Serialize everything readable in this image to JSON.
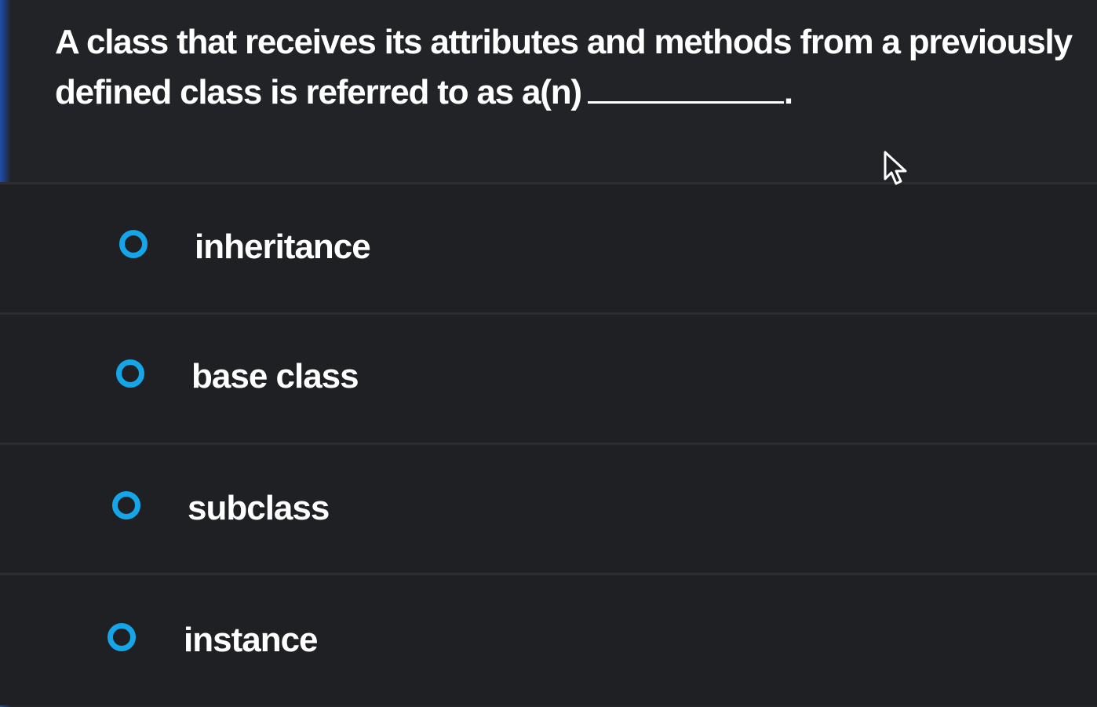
{
  "question": {
    "text": "A class that receives its attributes and methods from a previously defined class is referred to as a(n)",
    "trailing_punctuation": "."
  },
  "options": [
    {
      "label": "inheritance",
      "selected": false
    },
    {
      "label": "base class",
      "selected": false
    },
    {
      "label": "subclass",
      "selected": false
    },
    {
      "label": "instance",
      "selected": false
    }
  ],
  "colors": {
    "background": "#222326",
    "radio_accent": "#14a6e8",
    "text": "#ffffff"
  },
  "icons": {
    "radio": "radio-unselected-icon",
    "cursor": "mouse-pointer-icon"
  }
}
